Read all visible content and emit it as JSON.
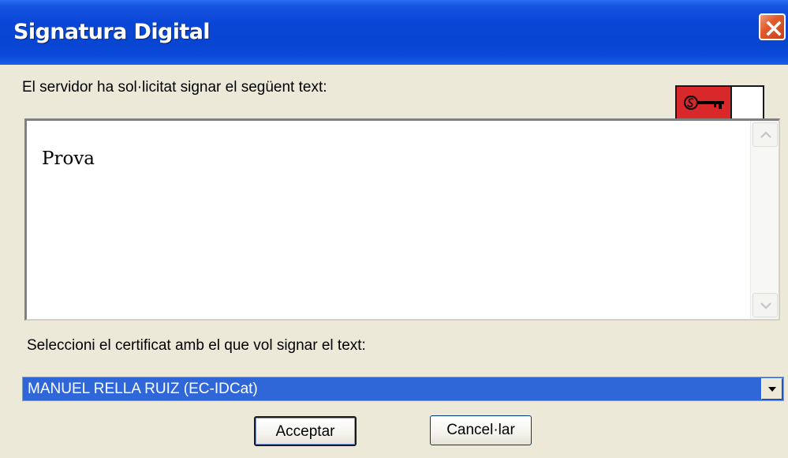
{
  "window": {
    "title": "Signatura Digital"
  },
  "prompt": {
    "label": "El servidor ha sol·licitat signar el següent text:"
  },
  "text_panel": {
    "content": "Prova"
  },
  "certificate": {
    "label": "Seleccioni el certificat amb el que vol signar el text:",
    "selected": "MANUEL RELLA RUIZ (EC-IDCat)"
  },
  "buttons": {
    "accept": "Acceptar",
    "cancel": "Cancel·lar"
  },
  "icons": {
    "close": "close-icon",
    "key": "key-icon",
    "scroll_up": "arrow-up-icon",
    "scroll_down": "arrow-down-icon",
    "dropdown": "chevron-down-icon"
  },
  "colors": {
    "titlebar": "#0845d1",
    "close_button": "#e05a2c",
    "key_badge": "#d8282a",
    "selection": "#2f67d8",
    "dialog_bg": "#ece9d8"
  }
}
